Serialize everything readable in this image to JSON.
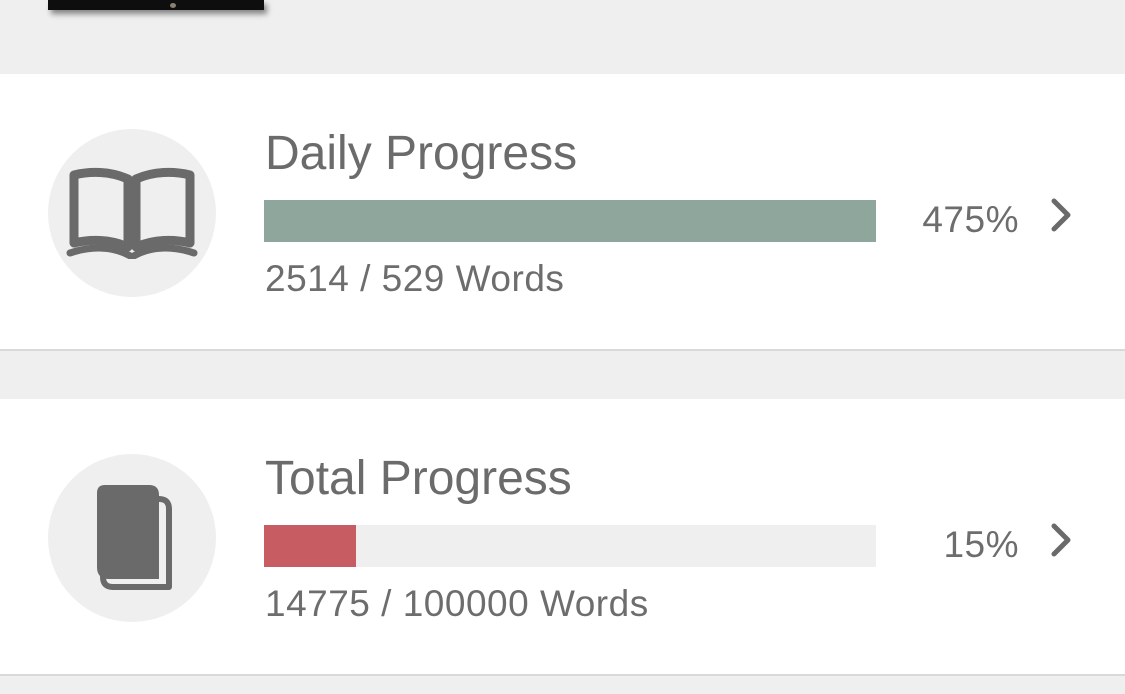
{
  "colors": {
    "background": "#efefef",
    "card": "#ffffff",
    "daily_fill": "#8ea69c",
    "total_fill": "#c85c63",
    "track": "#efefef",
    "text": "#6b6b6b",
    "icon": "#6a6a6a"
  },
  "daily": {
    "icon": "open-book-icon",
    "title": "Daily Progress",
    "percent_label": "475%",
    "progress_fraction": 1.0,
    "words_label": "2514 / 529 Words"
  },
  "total": {
    "icon": "closed-book-icon",
    "title": "Total Progress",
    "percent_label": "15%",
    "progress_fraction": 0.15,
    "words_label": "14775 / 100000 Words"
  }
}
